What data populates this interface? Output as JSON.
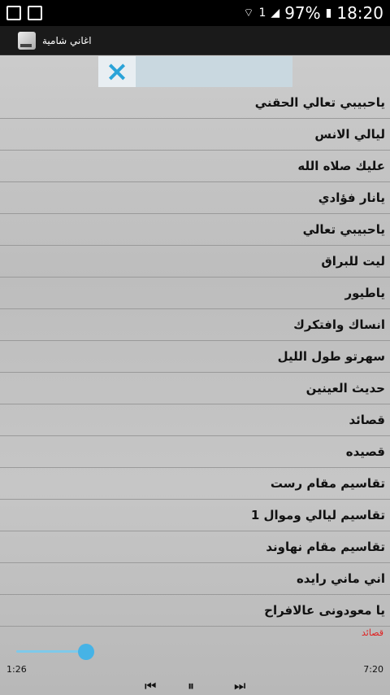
{
  "statusbar": {
    "battery": "97%",
    "time": "18:20",
    "sim_badge": "1"
  },
  "appbar": {
    "title": "اغاني شامية"
  },
  "ad": {
    "close_label": "×"
  },
  "songs": [
    "ياحبيبي تعالي الحقني",
    "ليالي الانس",
    "عليك صلاه الله",
    "يانار فؤادي",
    "ياحبيبي تعالي",
    "ليت للبراق",
    "ياطيور",
    "انساك وافتكرك",
    "سهرتو طول الليل",
    "حديث العينين",
    "قصائد",
    "قصيده",
    "تقاسيم مقام رست",
    "تقاسيم ليالي وموال 1",
    "تقاسيم مقام نهاوند",
    "اني ماني رايده",
    "يا معودونى عالافراح"
  ],
  "player": {
    "current_label": "قصائد",
    "elapsed": "1:26",
    "duration": "7:20",
    "progress_fraction": 0.195,
    "prev_icon": "skip-previous-icon",
    "pause_icon": "pause-icon",
    "next_icon": "skip-next-icon"
  }
}
